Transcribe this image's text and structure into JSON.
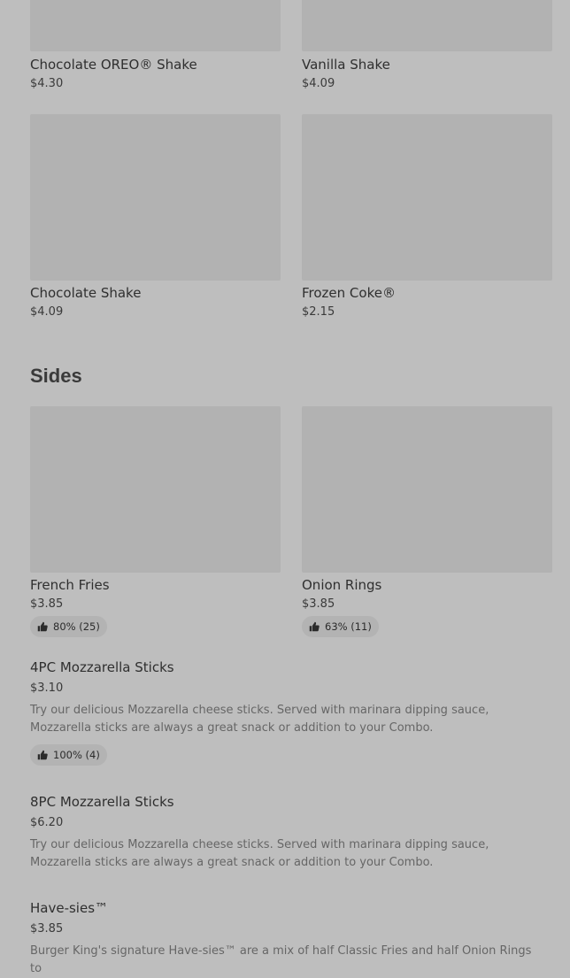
{
  "shakes": [
    {
      "name": "Chocolate OREO® Shake",
      "price": "$4.30"
    },
    {
      "name": "Vanilla Shake",
      "price": "$4.09"
    },
    {
      "name": "Chocolate Shake",
      "price": "$4.09"
    },
    {
      "name": "Frozen Coke®",
      "price": "$2.15"
    }
  ],
  "sides": {
    "title": "Sides",
    "cards": [
      {
        "name": "French Fries",
        "price": "$3.85",
        "rating": "80% (25)"
      },
      {
        "name": "Onion Rings",
        "price": "$3.85",
        "rating": "63% (11)"
      }
    ],
    "items": [
      {
        "name": "4PC Mozzarella Sticks",
        "price": "$3.10",
        "desc": "Try our delicious Mozzarella cheese sticks. Served with marinara dipping sauce, Mozzarella sticks are always a great snack or addition to your Combo.",
        "rating": "100% (4)"
      },
      {
        "name": "8PC Mozzarella Sticks",
        "price": "$6.20",
        "desc": "Try our delicious Mozzarella cheese sticks. Served with marinara dipping sauce, Mozzarella sticks are always a great snack or addition to your Combo."
      },
      {
        "name": "Have-sies™",
        "price": "$3.85",
        "desc": "Burger King's signature Have-sies™ are a mix of half Classic Fries and half Onion Rings to"
      }
    ]
  }
}
